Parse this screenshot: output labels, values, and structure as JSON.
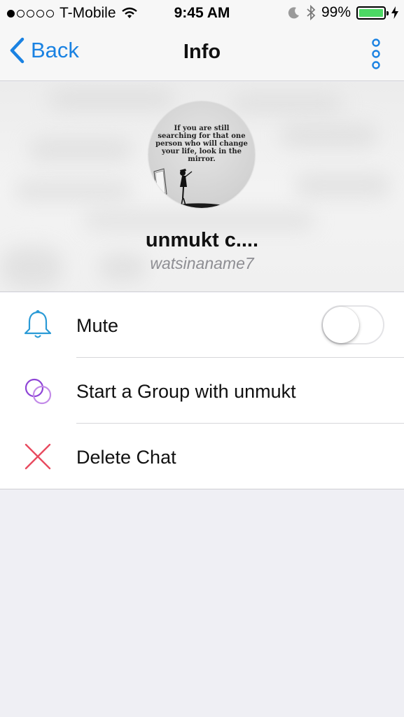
{
  "status_bar": {
    "carrier": "T-Mobile",
    "time": "9:45 AM",
    "battery": "99%",
    "battery_level": 0.99,
    "signal_bars": 1,
    "icons": [
      "signal-dots-icon",
      "wifi-icon",
      "moon-icon",
      "bluetooth-icon",
      "battery-icon",
      "charging-bolt-icon"
    ]
  },
  "nav": {
    "back_label": "Back",
    "title": "Info",
    "more_icon": "vertical-dots-icon",
    "accent": "#1a82e2"
  },
  "profile": {
    "avatar_quote": "If you are still searching for that one person who will change your life, look in the mirror.",
    "name": "unmukt c....",
    "username": "watsinaname7"
  },
  "list": {
    "items": [
      {
        "label": "Mute",
        "icon": "bell-icon",
        "icon_color": "#2a9ad6",
        "toggle_on": false
      },
      {
        "label": "Start a Group with unmukt",
        "icon": "group-circles-icon",
        "icon_color": "#9b59d6"
      },
      {
        "label": "Delete Chat",
        "icon": "delete-x-icon",
        "icon_color": "#e84a5f"
      }
    ]
  }
}
